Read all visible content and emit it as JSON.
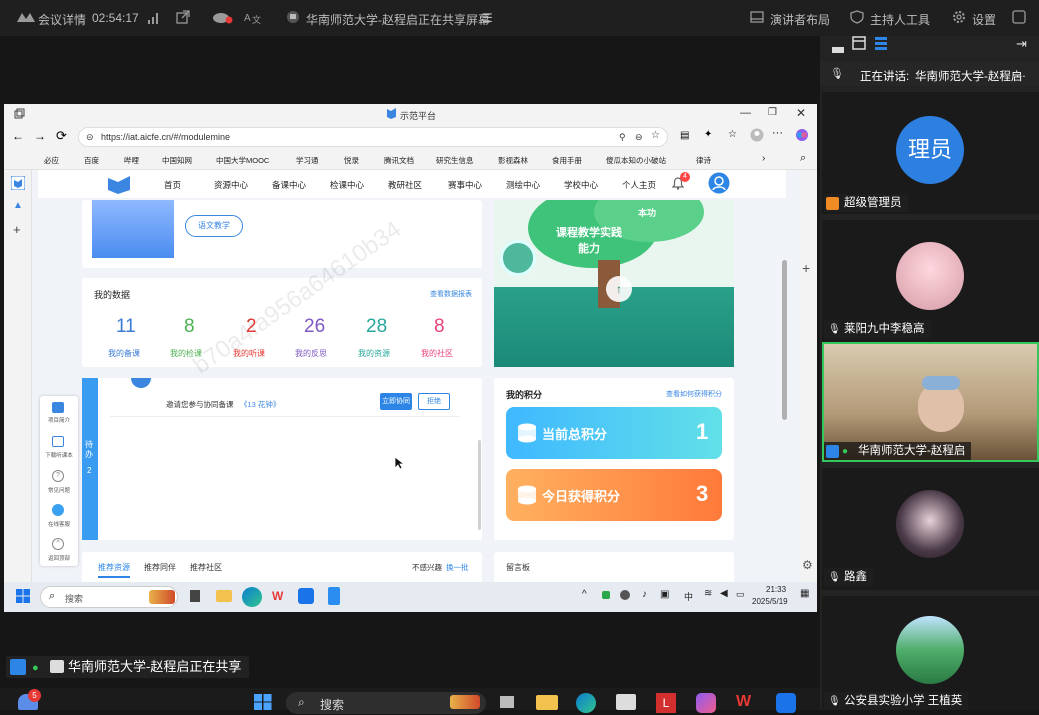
{
  "topbar": {
    "meeting_details": "会议详情",
    "timer": "02:54:17",
    "share_title": "华南师范大学-赵程启正在共享屏幕",
    "speaker_layout": "演讲者布局",
    "host_tools": "主持人工具",
    "settings": "设置"
  },
  "browser": {
    "tab_title": "示范平台",
    "url": "https://iat.aicfe.cn/#/modulemine",
    "favorites": [
      "必应",
      "百度",
      "哔哩",
      "中国知网",
      "中国大学MOOC",
      "学习通",
      "悦录",
      "腾讯文档",
      "研究生信息",
      "影视森林",
      "食用手册",
      "傻瓜本知の小破站",
      "律诗"
    ]
  },
  "site": {
    "nav": [
      "首页",
      "资源中心",
      "备课中心",
      "检课中心",
      "教研社区",
      "赛事中心",
      "测绘中心",
      "学校中心",
      "个人主页"
    ],
    "notif_count": "4",
    "lesson_button": "语文教学",
    "hero_text_1": "课程教学实践能力",
    "hero_text_2": "本功",
    "my_data": {
      "title": "我的数据",
      "report_link": "查看数据报表",
      "stats": [
        {
          "value": "11",
          "label": "我的备课",
          "color": "#3a7bd5"
        },
        {
          "value": "8",
          "label": "我的检课",
          "color": "#4caf50"
        },
        {
          "value": "2",
          "label": "我的听课",
          "color": "#e53935"
        },
        {
          "value": "26",
          "label": "我的反思",
          "color": "#7e57c2"
        },
        {
          "value": "28",
          "label": "我的资源",
          "color": "#26a69a"
        },
        {
          "value": "8",
          "label": "我的社区",
          "color": "#ec407a"
        }
      ]
    },
    "todo": {
      "tab_label": "待办",
      "count": "2",
      "invite_text": "邀请您参与协同备课",
      "invite_title": "《13 花钟》",
      "join_button": "立即协同",
      "reject_button": "拒绝"
    },
    "points": {
      "title": "我的积分",
      "how_link": "查看如何获得积分",
      "total_label": "当前总积分",
      "total_value": "1",
      "today_label": "今日获得积分",
      "today_value": "3"
    },
    "side_tools": [
      "项目简介",
      "下载听课本",
      "常见问题",
      "在线客服",
      "返回顶部"
    ],
    "recommend": {
      "tabs": [
        "推荐资源",
        "推荐同伴",
        "推荐社区"
      ],
      "not_interested": "不感兴趣",
      "refresh": "换一批",
      "board": "留言板"
    }
  },
  "inner_taskbar": {
    "search": "搜索",
    "time": "21:33",
    "date": "2025/5/19",
    "lang": "中"
  },
  "participants": {
    "speaking_label": "正在讲话:",
    "speaking_name": "华南师范大学-赵程启",
    "list": [
      {
        "avatar_text": "理员",
        "name": "超级管理员"
      },
      {
        "name": "莱阳九中李稳高"
      },
      {
        "name": "华南师范大学-赵程启"
      },
      {
        "name": "路鑫"
      },
      {
        "name": "公安县实验小学 王植英"
      }
    ]
  },
  "share_banner": "华南师范大学-赵程启正在共享",
  "win_taskbar": {
    "search": "搜索",
    "badge": "5"
  }
}
